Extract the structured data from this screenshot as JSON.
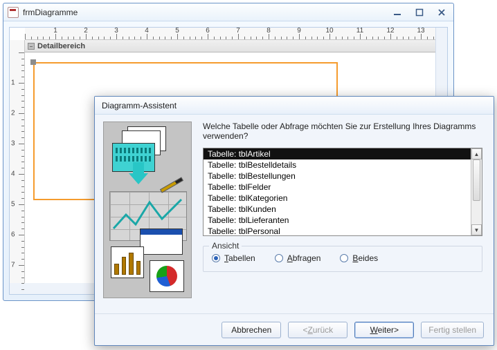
{
  "bgwin": {
    "title": "frmDiagramme",
    "section_header": "Detailbereich",
    "ruler_labels": [
      "1",
      "2",
      "3",
      "4",
      "5",
      "6",
      "7",
      "8",
      "9",
      "10",
      "11",
      "12",
      "13"
    ],
    "vruler_labels": [
      "1",
      "2",
      "3",
      "4",
      "5",
      "6",
      "7"
    ]
  },
  "dialog": {
    "title": "Diagramm-Assistent",
    "prompt": "Welche Tabelle oder Abfrage möchten Sie zur Erstellung Ihres Diagramms verwenden?",
    "list": {
      "items": [
        "Tabelle: tblArtikel",
        "Tabelle: tblBestelldetails",
        "Tabelle: tblBestellungen",
        "Tabelle: tblFelder",
        "Tabelle: tblKategorien",
        "Tabelle: tblKunden",
        "Tabelle: tblLieferanten",
        "Tabelle: tblPersonal"
      ],
      "selected_index": 0
    },
    "view_group": {
      "legend": "Ansicht",
      "options": [
        {
          "label": "Tabellen",
          "checked": true
        },
        {
          "label": "Abfragen",
          "checked": false
        },
        {
          "label": "Beides",
          "checked": false
        }
      ]
    },
    "buttons": {
      "cancel": "Abbrechen",
      "back": "< Zurück",
      "next": "Weiter >",
      "finish": "Fertig stellen"
    }
  }
}
